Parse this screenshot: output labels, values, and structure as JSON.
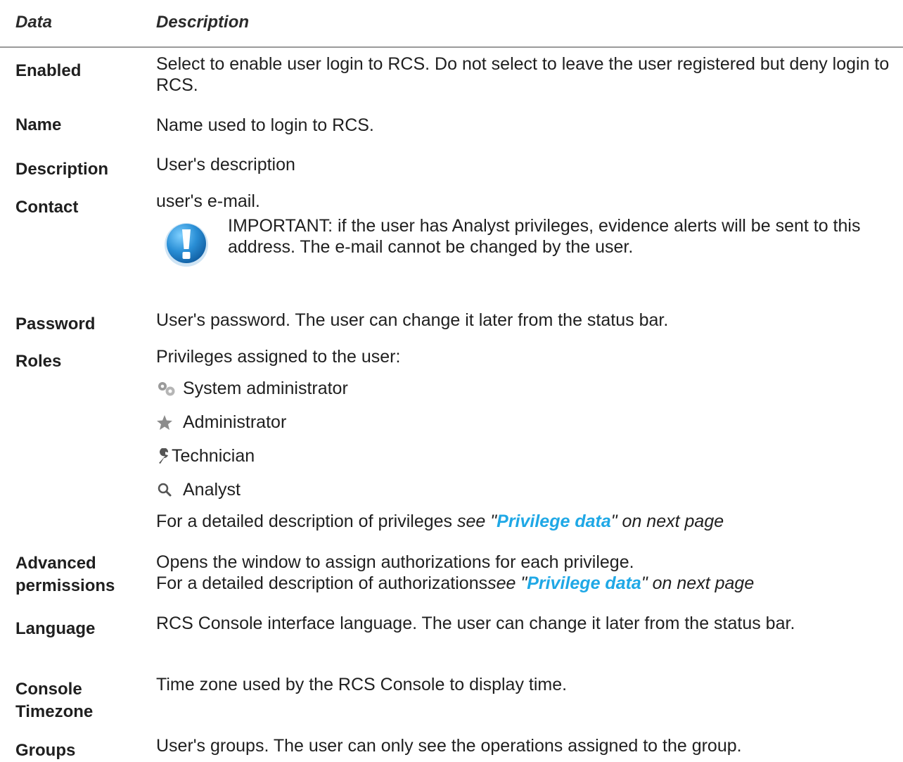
{
  "header": {
    "col_data": "Data",
    "col_description": "Description"
  },
  "rows": [
    {
      "term": "Enabled",
      "desc": "Select to enable user login to RCS. Do not select to leave the user registered but deny login to RCS."
    },
    {
      "term": "Name",
      "desc": "Name used to login to RCS."
    },
    {
      "term": "Description",
      "desc": "User's description"
    },
    {
      "term": "Contact",
      "desc": "user's e-mail.",
      "note": {
        "icon": "important-exclamation-icon",
        "text": "IMPORTANT: if the user has Analyst privileges, evidence alerts will be sent to this address. The e-mail cannot be changed by the user."
      }
    },
    {
      "term": "Password",
      "desc": "User's password. The user can change it later from the status bar."
    },
    {
      "term": "Roles",
      "desc": "Privileges assigned to the user:",
      "roles": [
        {
          "icon": "gears-icon",
          "label": "System administrator"
        },
        {
          "icon": "star-icon",
          "label": "Administrator"
        },
        {
          "icon": "wrench-icon",
          "label": "Technician"
        },
        {
          "icon": "magnifier-icon",
          "label": "Analyst"
        }
      ],
      "ref_prefix": "For a detailed description of privileges ",
      "ref_see": "see \"",
      "ref_link": "Privilege data",
      "ref_suffix": "\" on next page"
    },
    {
      "term_line1": "Advanced",
      "term_line2": "permissions",
      "desc": "Opens the window to assign authorizations for each privilege.",
      "ref_prefix": "For a detailed description of authorizations",
      "ref_see": "see \"",
      "ref_link": "Privilege data",
      "ref_suffix": "\" on next page"
    },
    {
      "term": "Language",
      "desc": "RCS Console interface language. The user can change it later from the status bar."
    },
    {
      "term_line1": "Console",
      "term_line2": "Timezone",
      "desc": "Time zone used by the RCS Console to display time."
    },
    {
      "term": "Groups",
      "desc": "User's groups. The user can only see the operations assigned to the group."
    }
  ],
  "colors": {
    "link": "#1fa8e6",
    "note_icon": "#2a8fd6",
    "rule": "#9a9a9a"
  }
}
